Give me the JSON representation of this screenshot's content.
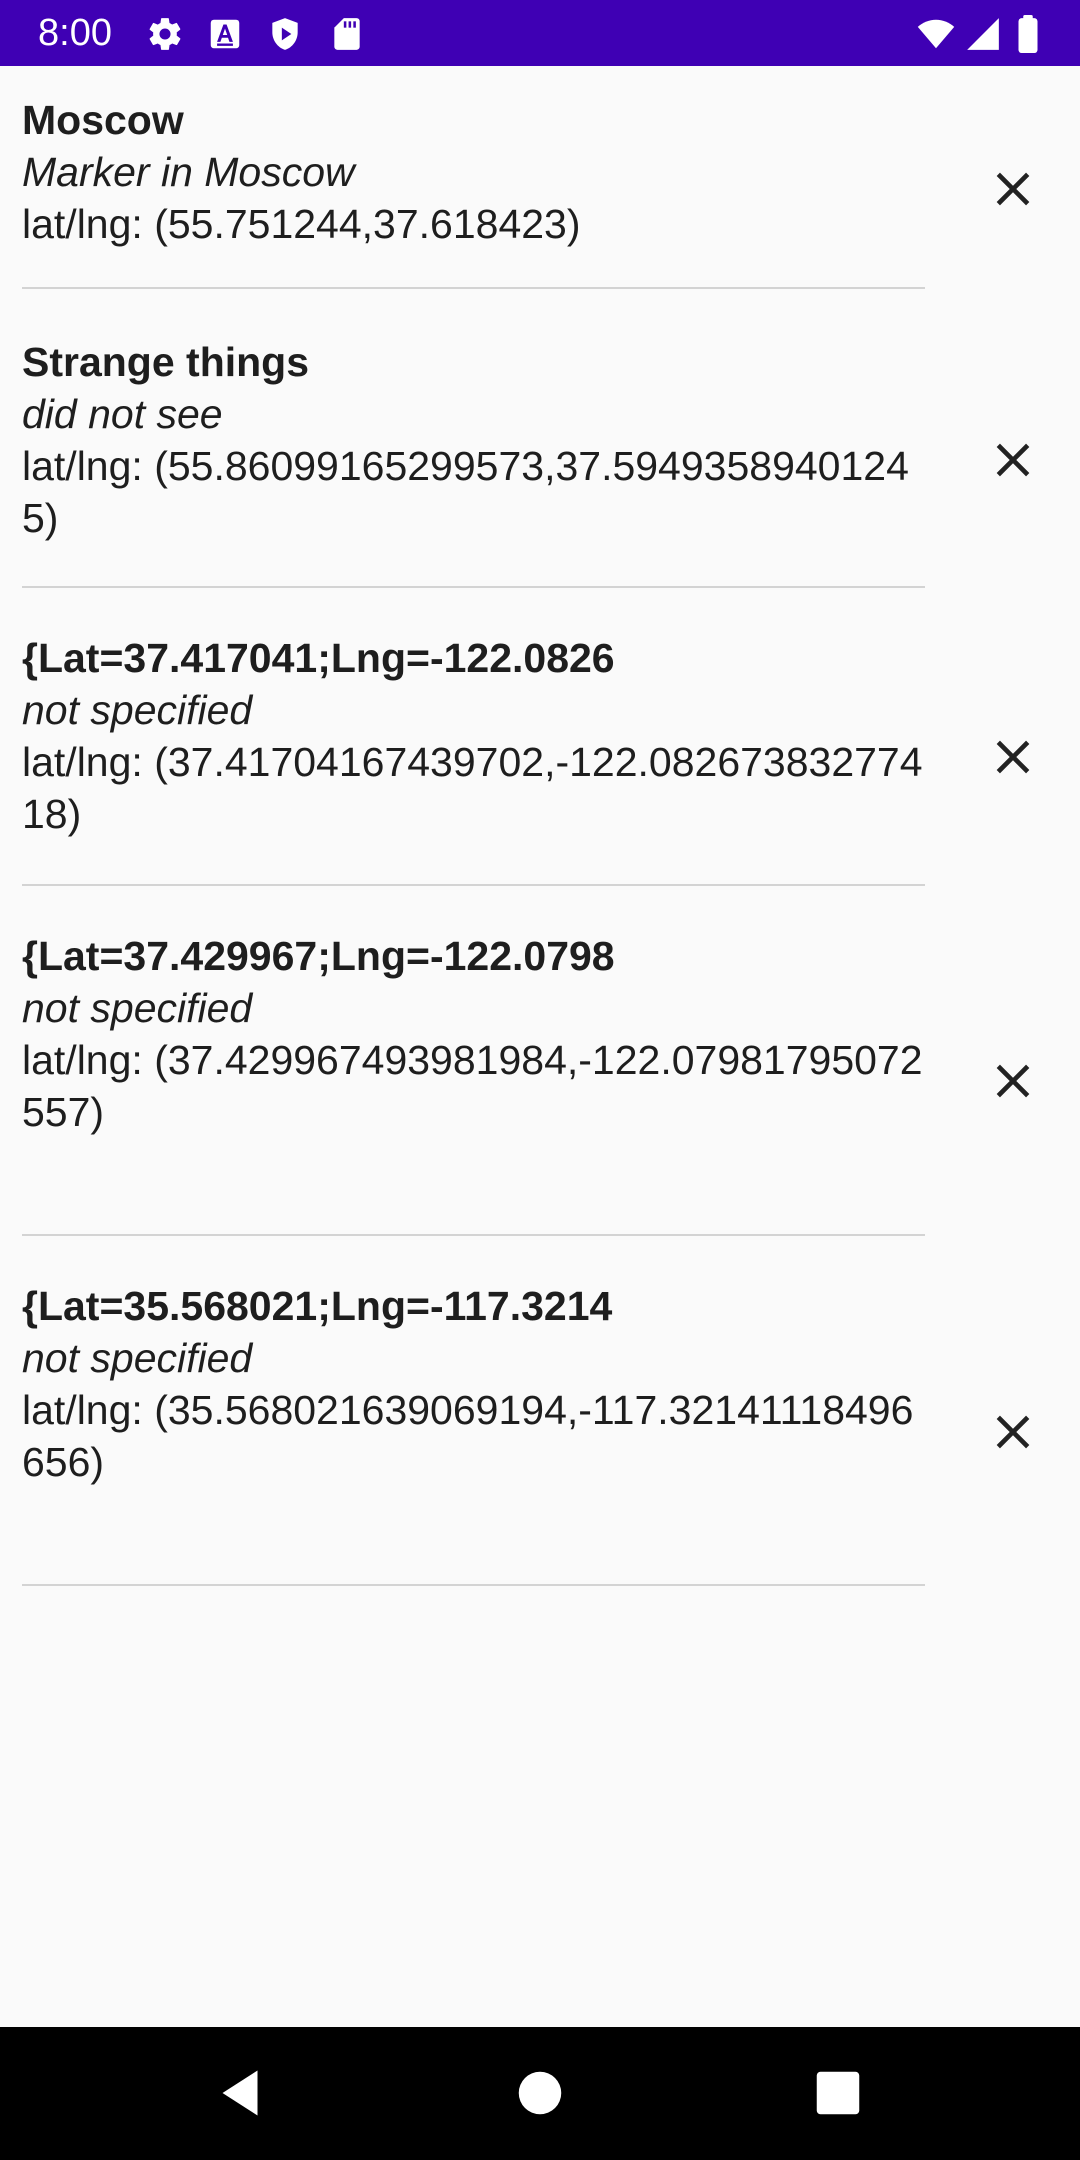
{
  "status_bar": {
    "time": "8:00",
    "left_icons": [
      "settings-icon",
      "font-a-icon",
      "shield-play-icon",
      "sd-card-icon"
    ],
    "right_icons": [
      "wifi-icon",
      "signal-icon",
      "battery-icon"
    ],
    "background": "#3f00b4"
  },
  "markers": [
    {
      "title": "Moscow",
      "description": "Marker in Moscow",
      "coords": "lat/lng: (55.751244,37.618423)",
      "delete_icon": "close-icon"
    },
    {
      "title": "Strange things",
      "description": "did not see",
      "coords": "lat/lng: (55.86099165299573,37.59493589401245)",
      "delete_icon": "close-icon"
    },
    {
      "title": "{Lat=37.417041;Lng=-122.0826",
      "description": "not specified",
      "coords": "lat/lng: (37.41704167439702,-122.08267383277418)",
      "delete_icon": "close-icon"
    },
    {
      "title": "{Lat=37.429967;Lng=-122.0798",
      "description": "not specified",
      "coords": "lat/lng: (37.429967493981984,-122.07981795072557)",
      "delete_icon": "close-icon"
    },
    {
      "title": "{Lat=35.568021;Lng=-117.3214",
      "description": "not specified",
      "coords": "lat/lng: (35.568021639069194,-117.32141118496656)",
      "delete_icon": "close-icon"
    }
  ],
  "nav_bar": {
    "buttons": [
      "back-icon",
      "home-icon",
      "recents-icon"
    ]
  }
}
